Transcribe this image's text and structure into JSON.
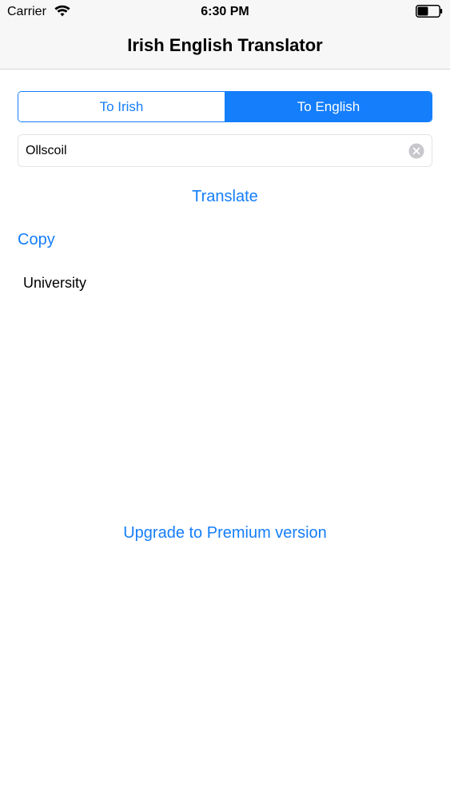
{
  "status_bar": {
    "carrier": "Carrier",
    "time": "6:30 PM",
    "battery_level": 0.5
  },
  "nav": {
    "title": "Irish English Translator"
  },
  "segmented_control": {
    "options": [
      "To Irish",
      "To English"
    ],
    "selected": "To English"
  },
  "input": {
    "value": "Ollscoil",
    "placeholder": ""
  },
  "actions": {
    "translate_label": "Translate",
    "copy_label": "Copy",
    "upgrade_label": "Upgrade to Premium version"
  },
  "result": {
    "text": "University"
  },
  "colors": {
    "accent": "#147efb",
    "nav_background": "#f7f7f7",
    "text": "#000000"
  },
  "icons": {
    "wifi": "wifi-icon",
    "battery": "battery-icon",
    "clear": "clear-icon"
  }
}
